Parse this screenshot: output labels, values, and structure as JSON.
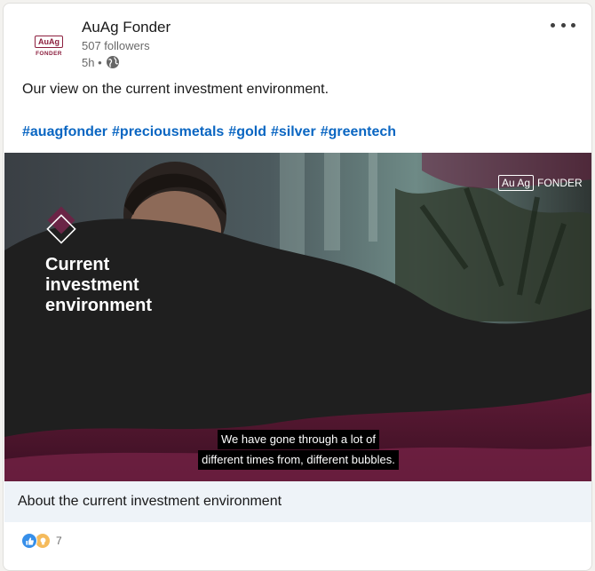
{
  "post": {
    "author": {
      "name": "AuAg Fonder",
      "followers": "507 followers",
      "time": "5h •",
      "logo_main": "AuAg",
      "logo_sub": "FONDER"
    },
    "text": "Our view on the current investment environment.",
    "hashtags": [
      "#auagfonder",
      "#preciousmetals",
      "#gold",
      "#silver",
      "#greentech"
    ],
    "video": {
      "brand_box": "Au Ag",
      "brand_word": "FONDER",
      "title_lines": [
        "Current",
        "investment",
        "environment"
      ],
      "subtitle_lines": [
        "We have gone through a lot of",
        "different times from, different bubbles."
      ]
    },
    "caption": "About the current investment environment",
    "reactions": {
      "count": "7",
      "icons": [
        "like-icon",
        "insightful-icon"
      ]
    }
  },
  "colors": {
    "brand": "#8c1f3e",
    "hashtag": "#0a66c2",
    "like": "#378fe9",
    "insightful": "#f5bb5c",
    "caption_bg": "#eef3f8"
  }
}
